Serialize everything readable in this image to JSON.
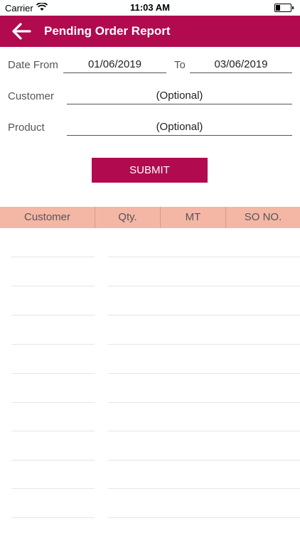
{
  "status": {
    "carrier": "Carrier",
    "time": "11:03 AM"
  },
  "header": {
    "title": "Pending Order Report",
    "back_icon": "arrow-left-icon"
  },
  "form": {
    "date_from_label": "Date From",
    "date_from_value": "01/06/2019",
    "to_label": "To",
    "to_value": "03/06/2019",
    "customer_label": "Customer",
    "customer_value": "(Optional)",
    "product_label": "Product",
    "product_value": "(Optional)",
    "submit_label": "SUBMIT"
  },
  "table": {
    "columns": [
      "Customer",
      "Qty.",
      "MT",
      "SO NO."
    ],
    "rows": []
  },
  "colors": {
    "brand": "#b10a4f",
    "header_bg": "#f4b7a6"
  }
}
